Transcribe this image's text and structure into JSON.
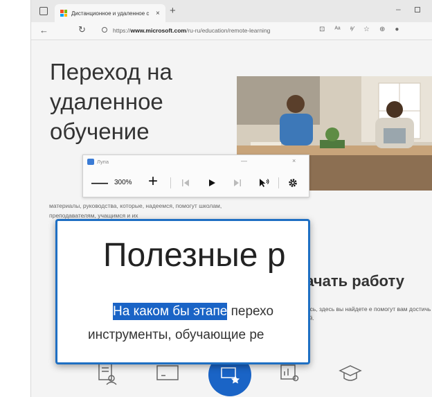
{
  "browser": {
    "tab_title": "Дистанционное и удаленное с",
    "url_prefix": "https://",
    "url_domain": "www.microsoft.com",
    "url_path": "/ru-ru/education/remote-learning",
    "new_tab_label": "+",
    "tab_close": "×"
  },
  "page": {
    "hero_title": "Переход на удаленное обучение",
    "small_text": "материалы, руководства, которые, надеемся, помогут школам, преподавателям, учащимся и их",
    "section_title": "ы начать работу",
    "section_text": "и находились, здесь вы найдете е помогут вам достичь своих целей."
  },
  "magnifier": {
    "title": "Лупа",
    "zoom_level": "300%",
    "minimize": "—",
    "close": "×"
  },
  "lens": {
    "heading": "Полезные р",
    "line1_highlight": "На каком бы этапе",
    "line1_rest": " перехо",
    "line2": "инструменты, обучающие ре"
  },
  "colors": {
    "accent": "#1e6fc3",
    "highlight": "#1a64c6",
    "ms_red": "#f25022",
    "ms_green": "#7fba00",
    "ms_blue": "#00a4ef",
    "ms_yellow": "#ffb900"
  }
}
